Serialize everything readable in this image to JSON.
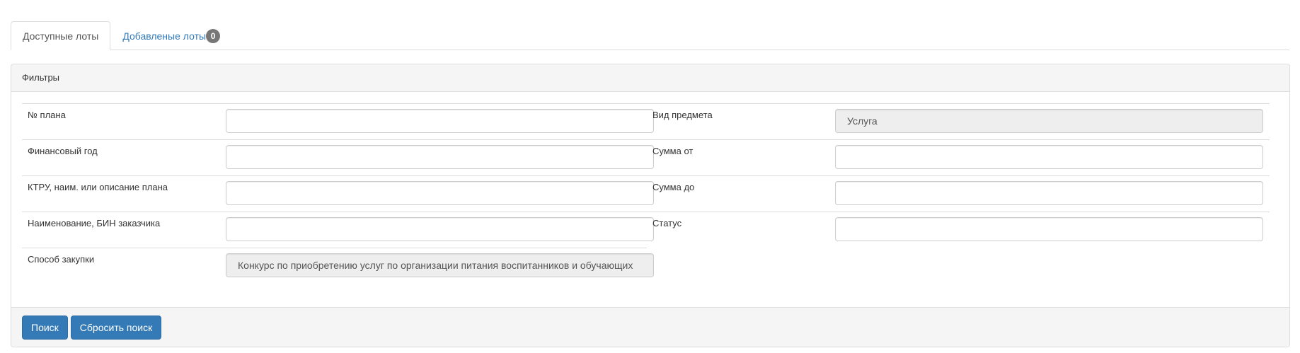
{
  "tabs": [
    {
      "label": "Доступные лоты",
      "active": true
    },
    {
      "label": "Добавленые лоты",
      "badge": "0",
      "active": false
    }
  ],
  "panel": {
    "heading": "Фильтры"
  },
  "filters": {
    "left": [
      {
        "label": "№ плана",
        "value": "",
        "disabled": false
      },
      {
        "label": "Финансовый год",
        "value": "",
        "disabled": false
      },
      {
        "label": "КТРУ, наим. или описание плана",
        "value": "",
        "disabled": false
      },
      {
        "label": "Наименование, БИН заказчика",
        "value": "",
        "disabled": false
      },
      {
        "label": "Способ закупки",
        "value": "Конкурс по приобретению услуг по организации питания воспитанников и обучающих",
        "disabled": true
      }
    ],
    "right": [
      {
        "label": "Вид предмета",
        "value": "Услуга",
        "disabled": true
      },
      {
        "label": "Сумма от",
        "value": "",
        "disabled": false
      },
      {
        "label": "Сумма до",
        "value": "",
        "disabled": false
      },
      {
        "label": "Статус",
        "value": "",
        "disabled": false
      }
    ]
  },
  "footer": {
    "search_label": "Поиск",
    "reset_label": "Сбросить поиск"
  },
  "colors": {
    "primary": "#337ab7",
    "badge": "#777777",
    "panel_bg": "#f5f5f5",
    "disabled_bg": "#eeeeee"
  }
}
